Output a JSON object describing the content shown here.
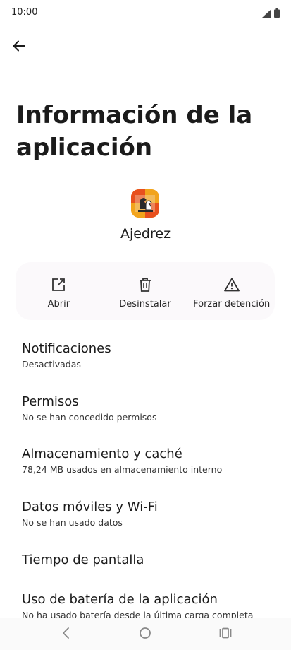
{
  "status_bar": {
    "time": "10:00",
    "icons": [
      "signal-icon",
      "battery-icon"
    ]
  },
  "header": {
    "back_icon": "arrow-left-icon",
    "title": "Información de la aplicación"
  },
  "app": {
    "name": "Ajedrez",
    "icon": "chess-app-icon",
    "icon_color": "#f2a41c"
  },
  "actions": [
    {
      "label": "Abrir",
      "icon": "open-external-icon"
    },
    {
      "label": "Desinstalar",
      "icon": "trash-icon"
    },
    {
      "label": "Forzar detención",
      "icon": "warning-icon"
    }
  ],
  "settings": [
    {
      "title": "Notificaciones",
      "subtitle": "Desactivadas"
    },
    {
      "title": "Permisos",
      "subtitle": "No se han concedido permisos"
    },
    {
      "title": "Almacenamiento y caché",
      "subtitle": "78,24 MB usados en almacenamiento interno"
    },
    {
      "title": "Datos móviles y Wi-Fi",
      "subtitle": "No se han usado datos"
    },
    {
      "title": "Tiempo de pantalla",
      "subtitle": ""
    },
    {
      "title": "Uso de batería de la aplicación",
      "subtitle": "No ha usado batería desde la última carga completa"
    }
  ],
  "nav_bar": {
    "buttons": [
      "back-nav-icon",
      "home-nav-icon",
      "recents-nav-icon"
    ]
  }
}
